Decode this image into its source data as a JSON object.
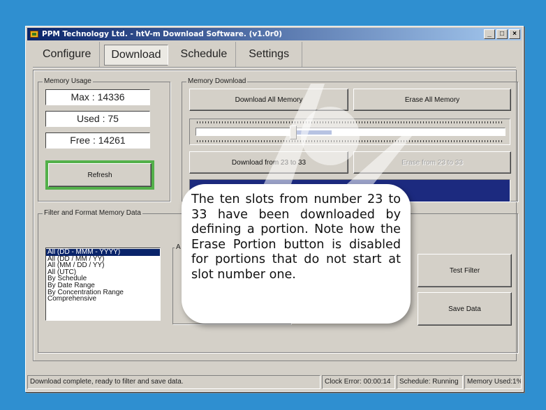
{
  "window": {
    "title": "PPM Technology Ltd. - htV-m Download Software. (v1.0r0)",
    "controls": [
      "_",
      "□",
      "×"
    ]
  },
  "tabs": [
    "Configure",
    "Download",
    "Schedule",
    "Settings"
  ],
  "active_tab": "Download",
  "memory_usage": {
    "legend": "Memory Usage",
    "max": "Max : 14336",
    "used": "Used : 75",
    "free": "Free : 14261",
    "refresh_label": "Refresh"
  },
  "memory_download": {
    "legend": "Memory Download",
    "download_all_label": "Download All Memory",
    "erase_all_label": "Erase All Memory",
    "download_range_label": "Download from 23 to 33",
    "erase_range_label": "Erase from 23 to 33",
    "range_start_fraction": 0.31,
    "range_end_fraction": 0.44
  },
  "filter": {
    "legend": "Filter and Format Memory Data",
    "inner_legend": "A",
    "options": [
      "All (DD - MMM - YYYY)",
      "All (DD / MM / YY)",
      "All (MM / DD / YY)",
      "All (UTC)",
      "By Schedule",
      "By Date Range",
      "By Concentration Range",
      "Comprehensive"
    ],
    "selected_index": 0,
    "test_filter_label": "Test Filter",
    "save_data_label": "Save Data"
  },
  "status": {
    "message": "Download complete, ready to filter and save data.",
    "clock_error": "Clock Error: 00:00:14",
    "schedule": "Schedule: Running",
    "memory_used": "Memory Used:1%"
  },
  "callout": {
    "text": "The ten slots from number 23 to 33 have been downloaded by defining a portion. Note how the Erase Portion button is disabled for portions that do not start at slot number one."
  },
  "colors": {
    "background": "#2f8fd0",
    "title_bar": "#0a246a",
    "refresh_highlight": "#53b04a",
    "progress_fill": "#1c2a7f",
    "selection": "#0a246a"
  }
}
